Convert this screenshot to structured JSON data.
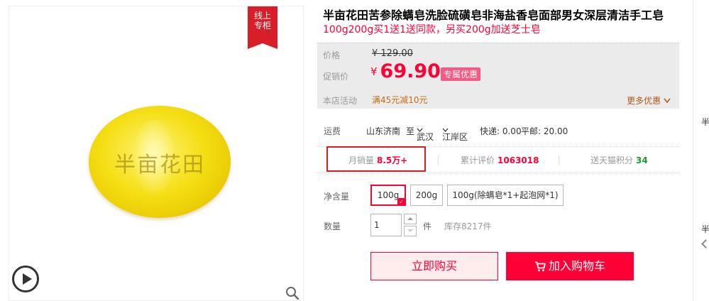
{
  "gallery": {
    "badge_line1": "线上",
    "badge_line2": "专柜",
    "product_image_text": "半亩花田"
  },
  "product": {
    "title": "半亩花田苦参除螨皂洗脸硫磺皂非海盐香皂面部男女深层清洁手工皂",
    "subtitle": "100g200g买1送1送同款，另买200g加送芝士皂"
  },
  "price": {
    "price_label": "价格",
    "original_price": "¥ 129.00",
    "promo_label": "促销价",
    "currency_symbol": "¥",
    "promo_price": "69.90",
    "promo_tag": "专属优惠",
    "activity_label": "本店活动",
    "activity_text": "满45元减10元",
    "more_offers": "更多优惠",
    "colors": {
      "accent": "#ff0036",
      "tag": "#f55a84",
      "activity": "#c46a14"
    }
  },
  "shipping": {
    "label": "运费",
    "from": "山东济南",
    "to_word": "至",
    "city": "武汉",
    "district": "江岸区",
    "express": "快递: 0.00",
    "mail": "平邮: 20.00"
  },
  "stats": {
    "monthly_sales_label": "月销量",
    "monthly_sales_value": "8.5万+",
    "reviews_label": "累计评价",
    "reviews_value": "1063018",
    "points_label": "送天猫积分",
    "points_value": "34"
  },
  "options": {
    "net_label": "净含量",
    "items": [
      "100g",
      "200g",
      "100g(除螨皂*1+起泡网*1)"
    ],
    "selected": "100g"
  },
  "quantity": {
    "label": "数量",
    "value": "1",
    "unit": "件",
    "stock": "库存8217件"
  },
  "actions": {
    "buy_now": "立即购买",
    "add_to_cart": "加入购物车"
  },
  "sidebar": {
    "text_1": "半",
    "text_2": "半"
  },
  "icons": [
    "play-icon",
    "zoom-icon",
    "cart-icon",
    "chevron-down-icon",
    "chevron-up-icon"
  ]
}
